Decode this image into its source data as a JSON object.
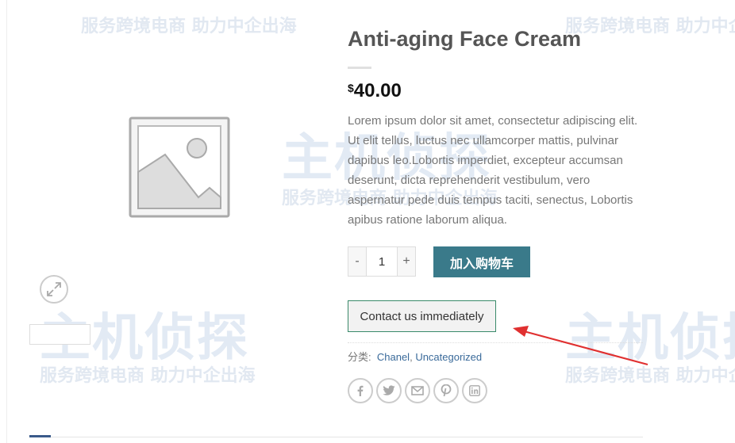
{
  "product": {
    "title": "Anti-aging Face Cream",
    "currency_symbol": "$",
    "price": "40.00",
    "description": "Lorem ipsum dolor sit amet, consectetur adipiscing elit. Ut elit tellus, luctus nec ullamcorper mattis, pulvinar dapibus leo.Lobortis imperdiet, excepteur accumsan deserunt, dicta reprehenderit vestibulum, vero aspernatur pede duis tempus taciti, senectus, Lobortis apibus ratione laborum aliqua."
  },
  "cart": {
    "minus_label": "-",
    "quantity": "1",
    "plus_label": "+",
    "add_to_cart_label": "加入购物车"
  },
  "contact_button_label": "Contact us immediately",
  "categories": {
    "label": "分类:",
    "items": [
      "Chanel",
      "Uncategorized"
    ],
    "separator": ","
  },
  "social_icons": [
    "facebook-icon",
    "twitter-icon",
    "email-icon",
    "pinterest-icon",
    "linkedin-icon"
  ],
  "watermark": {
    "brand": "主机侦探",
    "slogan": "服务跨境电商 助力中企出海"
  },
  "colors": {
    "add_to_cart_bg": "#3a7a8a",
    "link": "#3a6a9a",
    "annotation_arrow": "#e03030"
  }
}
